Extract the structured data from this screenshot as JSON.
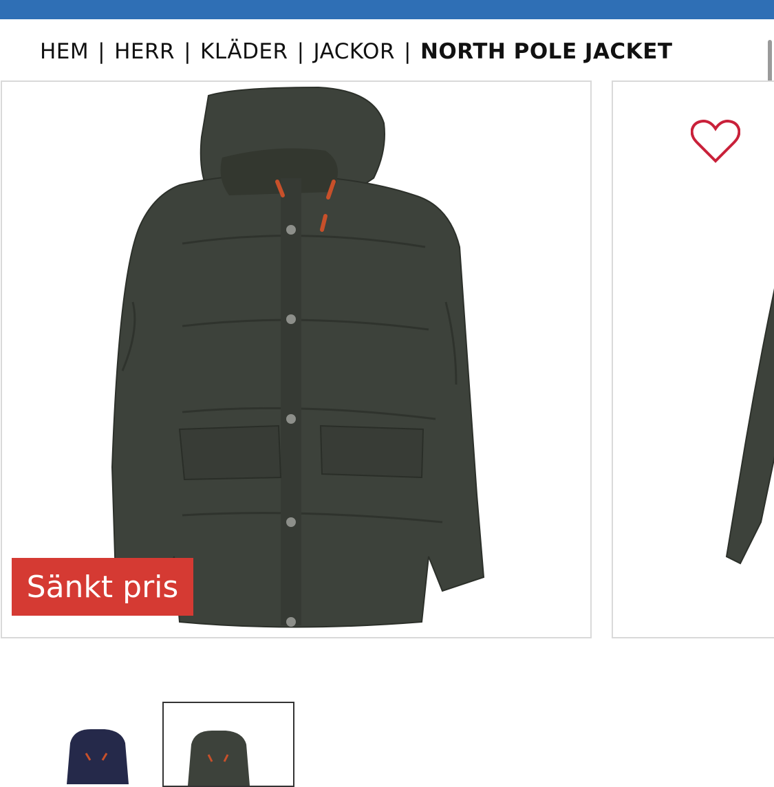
{
  "breadcrumb": {
    "items": [
      "HEM",
      "HERR",
      "KLÄDER",
      "JACKOR"
    ],
    "current": "NORTH POLE JACKET",
    "separator": "|"
  },
  "product": {
    "badge": "Sänkt pris",
    "jacket_color": "#3d423b",
    "accent_color": "#c8502a"
  },
  "thumbnails": [
    {
      "name": "navy",
      "color": "#25294a",
      "selected": false
    },
    {
      "name": "olive",
      "color": "#3d423b",
      "selected": true
    }
  ],
  "colors": {
    "topbar": "#2f6fb5",
    "badge": "#d53a33",
    "heart": "#c9213a"
  }
}
